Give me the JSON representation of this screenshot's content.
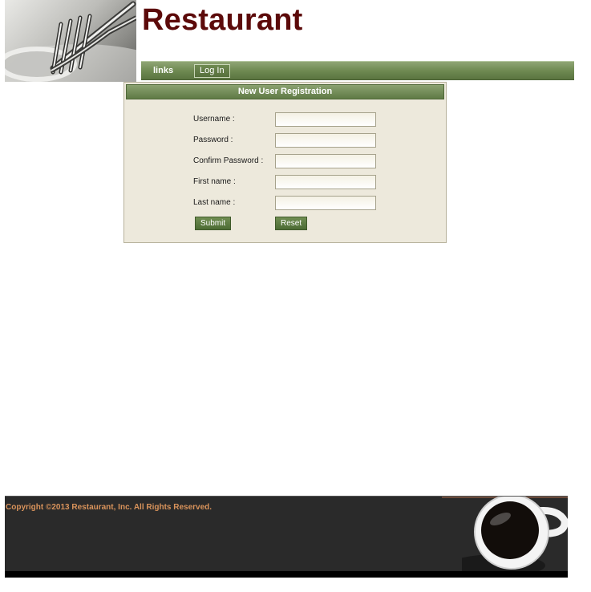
{
  "header": {
    "site_title": "Restaurant",
    "logo_image": "fork-spoon-photo",
    "title_color": "#5c0a0a"
  },
  "navbar": {
    "links_label": "links",
    "login_label": "Log In",
    "accent": "#6f8a52"
  },
  "registration": {
    "title": "New User Registration",
    "fields": [
      {
        "label": "Username :",
        "value": ""
      },
      {
        "label": "Password :",
        "value": ""
      },
      {
        "label": "Confirm Password :",
        "value": ""
      },
      {
        "label": "First name :",
        "value": ""
      },
      {
        "label": "Last name :",
        "value": ""
      }
    ],
    "submit_label": "Submit",
    "reset_label": "Reset"
  },
  "footer": {
    "copyright": "Copyright ©2013 Restaurant, Inc. All Rights Reserved.",
    "decor_image": "coffee-cup-photo",
    "copyright_color": "#d9935b"
  }
}
